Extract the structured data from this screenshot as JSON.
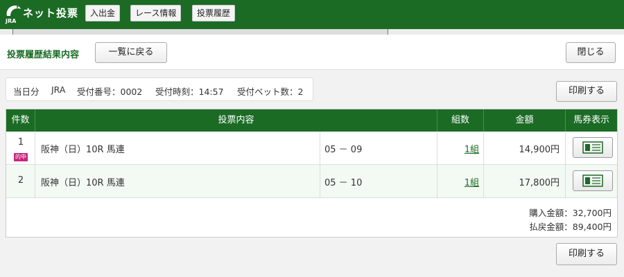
{
  "header": {
    "logo_text": "ネット投票",
    "logo_sub": "JRA",
    "nav": [
      "入出金",
      "レース情報",
      "投票履歴"
    ]
  },
  "panel": {
    "title": "投票履歴結果内容",
    "back_label": "一覧に戻る",
    "close_label": "閉じる",
    "print_label": "印刷する"
  },
  "info": {
    "day": "当日分",
    "org": "JRA",
    "receipt_no": "受付番号：0002",
    "receipt_time": "受付時刻：14:57",
    "bet_count": "受付ベット数：2"
  },
  "table": {
    "headers": [
      "件数",
      "投票内容",
      "組数",
      "金額",
      "馬券表示"
    ],
    "rows": [
      {
        "num": "1",
        "badge": "的中",
        "race": "阪神（日）10R 馬連",
        "combo": "05 － 09",
        "kumi": "1組",
        "amount": "14,900円"
      },
      {
        "num": "2",
        "badge": "",
        "race": "阪神（日）10R 馬連",
        "combo": "05 － 10",
        "kumi": "1組",
        "amount": "17,800円"
      }
    ]
  },
  "totals": {
    "purchase": "購入金額：32,700円",
    "payout": "払戻金額：89,400円"
  },
  "colors": {
    "brand_green": "#1b6b25",
    "hit_badge": "#c7247a"
  }
}
